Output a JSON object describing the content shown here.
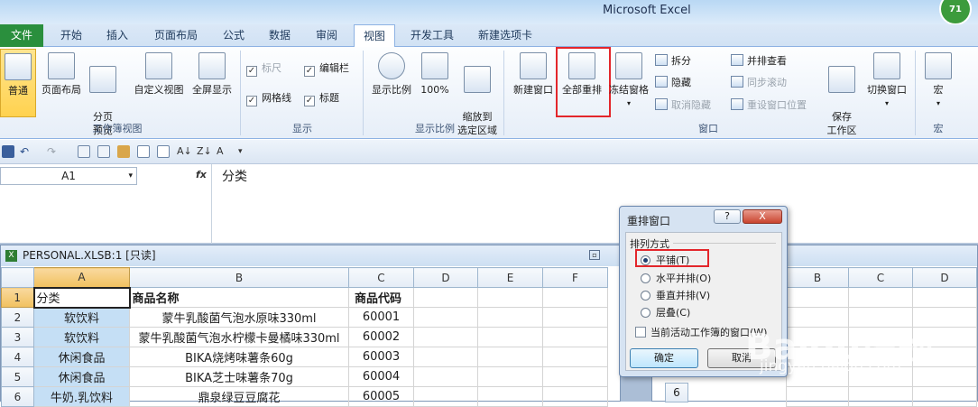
{
  "window": {
    "title": "Microsoft Excel",
    "badge": "71"
  },
  "tabs": [
    "文件",
    "开始",
    "插入",
    "页面布局",
    "公式",
    "数据",
    "审阅",
    "视图",
    "开发工具",
    "新建选项卡"
  ],
  "ribbon": {
    "workbook_views": {
      "label": "工作簿视图",
      "normal": "普通",
      "page_layout": "页面布局",
      "page_break": "分页\n预览",
      "custom_views": "自定义视图",
      "full_screen": "全屏显示"
    },
    "show": {
      "label": "显示",
      "ruler": "标尺",
      "formula_bar": "编辑栏",
      "gridlines": "网格线",
      "headings": "标题"
    },
    "zoom": {
      "label": "显示比例",
      "zoom": "显示比例",
      "hundred": "100%",
      "zoom_sel": "缩放到\n选定区域"
    },
    "window": {
      "label": "窗口",
      "new_window": "新建窗口",
      "arrange_all": "全部重排",
      "freeze": "冻结窗格",
      "split": "拆分",
      "hide": "隐藏",
      "unhide": "取消隐藏",
      "side_by_side": "并排查看",
      "sync_scroll": "同步滚动",
      "reset_pos": "重设窗口位置",
      "save_ws": "保存\n工作区",
      "switch": "切换窗口"
    },
    "macros": {
      "label": "宏",
      "macro": "宏"
    }
  },
  "formula": {
    "cell": "A1",
    "fx": "fx",
    "value": "分类"
  },
  "workbook1": {
    "title": "PERSONAL.XLSB:1  [只读]",
    "columns": [
      "A",
      "B",
      "C",
      "D",
      "E",
      "F"
    ],
    "rows": [
      {
        "num": "1",
        "a": "分类",
        "b": "商品名称",
        "c": "商品代码"
      },
      {
        "num": "2",
        "a": "软饮料",
        "b": "蒙牛乳酸菌气泡水原味330ml",
        "c": "60001"
      },
      {
        "num": "3",
        "a": "软饮料",
        "b": "蒙牛乳酸菌气泡水柠檬卡曼橘味330ml",
        "c": "60002"
      },
      {
        "num": "4",
        "a": "休闲食品",
        "b": "BIKA烧烤味薯条60g",
        "c": "60003"
      },
      {
        "num": "5",
        "a": "休闲食品",
        "b": "BIKA芝士味薯条70g",
        "c": "60004"
      },
      {
        "num": "6",
        "a": "牛奶.乳饮料",
        "b": "鼎泉绿豆豆腐花",
        "c": "60005"
      }
    ]
  },
  "workbook2": {
    "columns": [
      "B",
      "C",
      "D"
    ],
    "row6": "6"
  },
  "dialog": {
    "title": "重排窗口",
    "help": "?",
    "close": "X",
    "group": "排列方式",
    "options": [
      "平铺(T)",
      "水平并排(O)",
      "垂直并排(V)",
      "层叠(C)"
    ],
    "selected": 0,
    "checkbox": "当前活动工作簿的窗口(W)",
    "ok": "确定",
    "cancel": "取消"
  },
  "watermark": {
    "brand": "Baidu经验",
    "url": "jingyan.baidu.com"
  }
}
